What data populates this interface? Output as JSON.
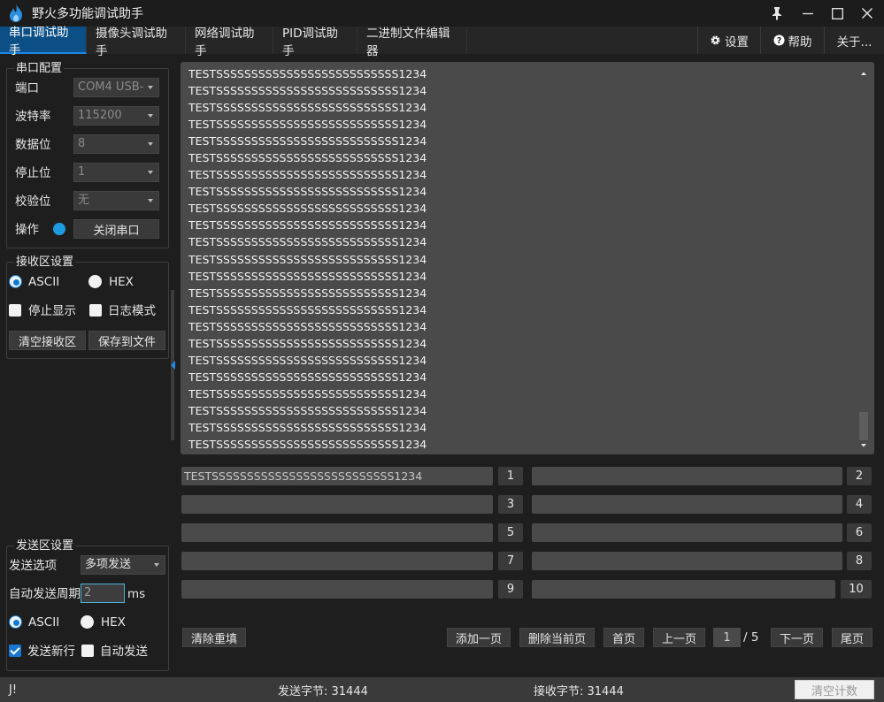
{
  "app": {
    "title": "野火多功能调试助手"
  },
  "tabs": [
    {
      "label": "串口调试助手",
      "active": true
    },
    {
      "label": "摄像头调试助手"
    },
    {
      "label": "网络调试助手"
    },
    {
      "label": "PID调试助手"
    },
    {
      "label": "二进制文件编辑器"
    }
  ],
  "tabs_right": {
    "settings": "设置",
    "help": "帮助",
    "about": "关于..."
  },
  "serial_config": {
    "title": "串口配置",
    "port_label": "端口",
    "port_value": "COM4 USB-",
    "baud_label": "波特率",
    "baud_value": "115200",
    "databits_label": "数据位",
    "databits_value": "8",
    "stopbits_label": "停止位",
    "stopbits_value": "1",
    "parity_label": "校验位",
    "parity_value": "无",
    "op_label": "操作",
    "close_button": "关闭串口"
  },
  "recv_settings": {
    "title": "接收区设置",
    "ascii": "ASCII",
    "hex": "HEX",
    "stop_display": "停止显示",
    "log_mode": "日志模式",
    "clear_button": "清空接收区",
    "save_button": "保存到文件"
  },
  "send_settings": {
    "title": "发送区设置",
    "option_label": "发送选项",
    "option_value": "多项发送",
    "period_label": "自动发送周期",
    "period_value": "2",
    "period_unit": "ms",
    "ascii": "ASCII",
    "hex": "HEX",
    "newline": "发送新行",
    "auto_send": "自动发送"
  },
  "receive_text": "TESTSSSSSSSSSSSSSSSSSSSSSSSSSS1234",
  "send_items": [
    {
      "text": "TESTSSSSSSSSSSSSSSSSSSSSSSSSSS1234",
      "num": "1"
    },
    {
      "text": "",
      "num": "2"
    },
    {
      "text": "",
      "num": "3"
    },
    {
      "text": "",
      "num": "4"
    },
    {
      "text": "",
      "num": "5"
    },
    {
      "text": "",
      "num": "6"
    },
    {
      "text": "",
      "num": "7"
    },
    {
      "text": "",
      "num": "8"
    },
    {
      "text": "",
      "num": "9"
    },
    {
      "text": "",
      "num": "10"
    }
  ],
  "bottom": {
    "reset": "清除重填",
    "add_page": "添加一页",
    "delete_page": "删除当前页",
    "first_page": "首页",
    "prev_page": "上一页",
    "current_page": "1",
    "total_pages": "/ 5",
    "next_page": "下一页",
    "last_page": "尾页"
  },
  "status": {
    "left": "J!",
    "sent": "发送字节: 31444",
    "received": "接收字节: 31444",
    "clear_count": "清空计数"
  },
  "colors": {
    "accent": "#1e88e5",
    "tab_active": "#0b4f86",
    "led": "#1e9be0"
  }
}
